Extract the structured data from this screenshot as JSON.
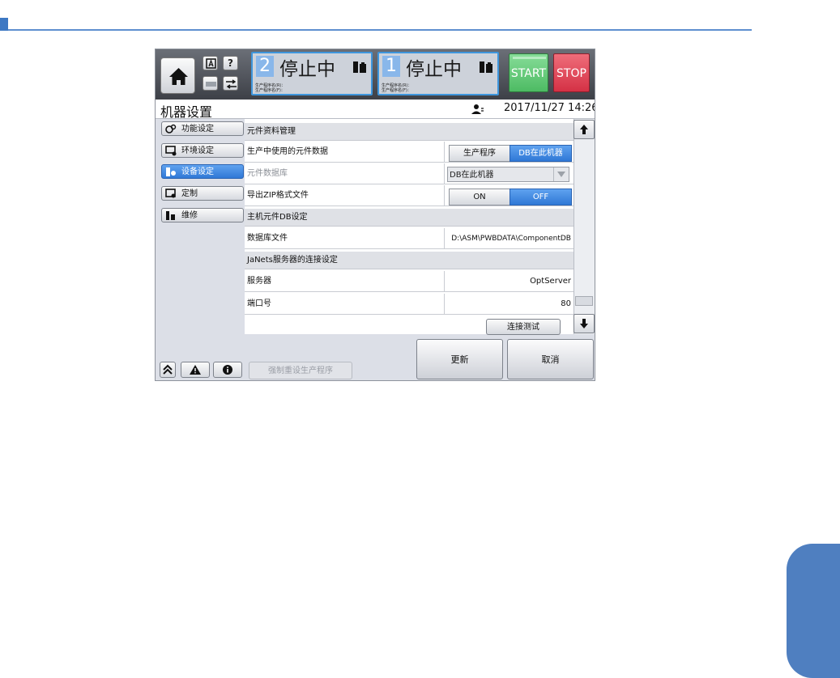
{
  "header": {
    "lanes": [
      {
        "number": "2",
        "status": "停止中",
        "prog_r": "生产程序名(R)：",
        "prog_f": "生产程序名(F)："
      },
      {
        "number": "1",
        "status": "停止中",
        "prog_r": "生产程序名(R)：",
        "prog_f": "生产程序名(F)："
      }
    ],
    "help_label": "?",
    "start_label": "START",
    "stop_label": "STOP"
  },
  "title_bar": {
    "title": "机器设置",
    "datetime": "2017/11/27 14:26"
  },
  "menu": {
    "items": [
      {
        "label": "功能设定",
        "icon": "gear-cluster-icon",
        "active": false
      },
      {
        "label": "环境设定",
        "icon": "monitor-settings-icon",
        "active": false
      },
      {
        "label": "设备设定",
        "icon": "device-settings-icon",
        "active": true
      },
      {
        "label": "定制",
        "icon": "custom-window-icon",
        "active": false
      },
      {
        "label": "维修",
        "icon": "maintenance-icon",
        "active": false
      }
    ]
  },
  "content": {
    "section1": {
      "title": "元件资料管理",
      "row1_label": "生产中使用的元件数据",
      "row1_opt_a": "生产程序",
      "row1_opt_b": "DB在此机器",
      "row2_label": "元件数据库",
      "row2_value": "DB在此机器",
      "row3_label": "导出ZIP格式文件",
      "row3_on": "ON",
      "row3_off": "OFF"
    },
    "section2": {
      "title": "主机元件DB设定",
      "row1_label": "数据库文件",
      "row1_value": "D:\\ASM\\PWBDATA\\ComponentDB"
    },
    "section3": {
      "title": "JaNets服务器的连接设定",
      "row1_label": "服务器",
      "row1_value": "OptServer",
      "row2_label": "端口号",
      "row2_value": "80"
    }
  },
  "actions": {
    "connection_test": "连接测试",
    "update": "更新",
    "cancel": "取消",
    "force_reset": "强制重设生产程序"
  },
  "colors": {
    "accent_blue": "#3e96dd",
    "active_blue": "#2f78d6",
    "start_green": "#4dbb63",
    "stop_red": "#d43145"
  }
}
